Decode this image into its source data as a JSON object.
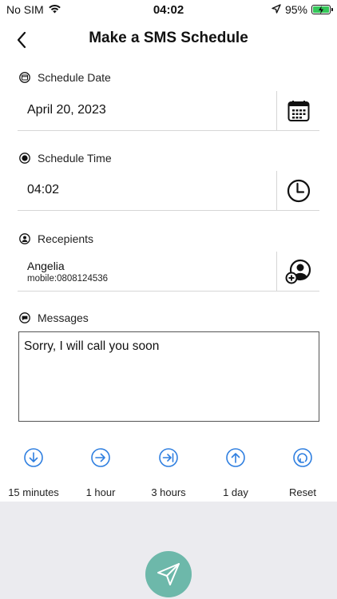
{
  "status_bar": {
    "carrier": "No SIM",
    "time": "04:02",
    "battery": "95%",
    "icons": [
      "wifi-icon",
      "location-arrow-icon",
      "battery-charging-icon"
    ]
  },
  "header": {
    "title": "Make a SMS Schedule",
    "back_icon": "chevron-left-icon"
  },
  "schedule_date": {
    "label": "Schedule Date",
    "value": "April 20, 2023",
    "icon": "calendar-icon"
  },
  "schedule_time": {
    "label": "Schedule Time",
    "value": "04:02",
    "icon": "clock-icon"
  },
  "recipients": {
    "label": "Recepients",
    "name": "Angelia",
    "mobile": "mobile:0808124536",
    "icon": "add-contact-icon"
  },
  "messages": {
    "label": "Messages",
    "text": "Sorry, I will call you soon"
  },
  "quick_actions": [
    {
      "label": "15 minutes",
      "icon": "arrow-down-circle-icon"
    },
    {
      "label": "1 hour",
      "icon": "arrow-right-circle-icon"
    },
    {
      "label": "3 hours",
      "icon": "arrow-to-end-circle-icon"
    },
    {
      "label": "1 day",
      "icon": "arrow-up-circle-icon"
    },
    {
      "label": "Reset",
      "icon": "reset-circle-icon"
    }
  ],
  "colors": {
    "accent_blue": "#2f7fe0",
    "send_button": "#6db8aa",
    "battery_green": "#34c759",
    "background_gray": "#ebebef"
  },
  "send_icon": "paper-plane-icon"
}
